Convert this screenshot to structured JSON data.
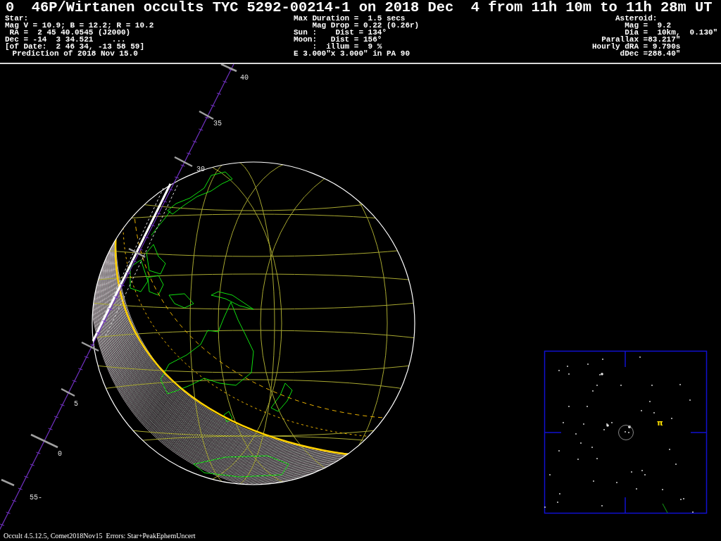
{
  "title": "0  46P/Wirtanen occults TYC 5292-00214-1 on 2018 Dec  4 from 11h 10m to 11h 28m UT",
  "star": [
    "Star:",
    "Mag V = 10.9; B = 12.2; R = 10.2",
    "RA =  2 45 40.0545 (J2000)",
    "Dec = -14  3 34.521    ...",
    "[of Date:  2 46 34, -13 58 59]",
    "Prediction of 2018 Nov 15.0"
  ],
  "event": [
    "Max Duration =  1.5 secs",
    "Mag Drop = 0.22 (0.26r)",
    "Sun :    Dist = 134°",
    "Moon:   Dist = 156°",
    ":  illum =  9 %",
    "E 3.000\"x 3.000\" in PA 90"
  ],
  "asteroid": [
    "Asteroid:",
    "Mag =  9.2",
    "Dia =  10km,  0.130\"",
    "Parallax =83.217\"",
    "Hourly dRA = 9.790s",
    "dDec =288.40\""
  ],
  "track_labels": [
    "40",
    "35",
    "30",
    "5",
    "0",
    "55-"
  ],
  "star_chart": {
    "marker": "π"
  },
  "footer": "Occult 4.5.12.5, Comet2018Nov15  Errors: Star+PeakEphemUncert"
}
